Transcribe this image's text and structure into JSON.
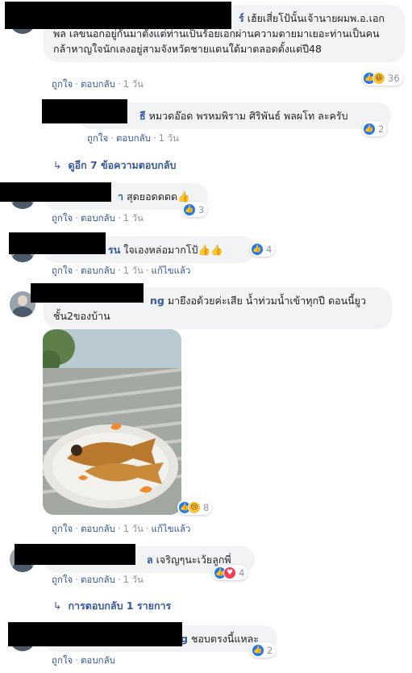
{
  "actions": {
    "like": "ถูกใจ",
    "reply": "ตอบกลับ",
    "edited": "แก้ไขแล้ว"
  },
  "comments": [
    {
      "name": "ร์",
      "text": "เฮ้ยเสี่ยโป้นั้นเจ้านายผมพ.อ.เอกพล เลขนอกอยู่กันมาตั้งแต่ท่านเป็นร้อยเอกผ่านความตายมาเยอะท่านเป็นคนกล้าหาญใจนักเลงอยู่สามจังหวัดชายแดนใต้มาตลอดตั้งแต่ปี48",
      "time": "1 วัน",
      "reaction_count": "36",
      "reactions": [
        "like-icon",
        "haha-icon"
      ]
    },
    {
      "name": "ธี",
      "text": "หมวดอ๊อด พรหมพิราม ศิริพันธ์ พลผโท ละครับ",
      "time": "1 วัน",
      "reaction_count": "2",
      "reactions": [
        "like-icon"
      ]
    },
    {
      "name": "า",
      "text": "สุดยอดดดด👍",
      "time": "1 วัน",
      "reaction_count": "3",
      "reactions": [
        "like-icon"
      ]
    },
    {
      "name": "รน",
      "text": "ใจเองหล่อมากโป้👍👍",
      "time": "1 วัน",
      "reaction_count": "4",
      "reactions": [
        "like-icon"
      ]
    },
    {
      "name": "ng",
      "text": "มายึงอด้วยค่ะเสีย น้ำท่วมน้ำเข้าทุกปี ดอนนี้ยูวชั้น2ของบ้าน",
      "time": "1 วัน",
      "reaction_count": "8",
      "reactions": [
        "like-icon",
        "sad-icon"
      ]
    },
    {
      "name": "ล",
      "text": "เจริญๆนะเว้ยลูกพี่",
      "time": "1 วัน",
      "reaction_count": "4",
      "reactions": [
        "like-icon",
        "love-icon"
      ]
    },
    {
      "name": "g",
      "text": "ชอบตรงนี้แหละ",
      "time": "",
      "reaction_count": "2",
      "reactions": [
        "like-icon"
      ]
    }
  ],
  "more_replies_1": "ดูอีก 7 ข้อความตอบกลับ",
  "more_replies_2": "การตอบกลับ 1 รายการ"
}
